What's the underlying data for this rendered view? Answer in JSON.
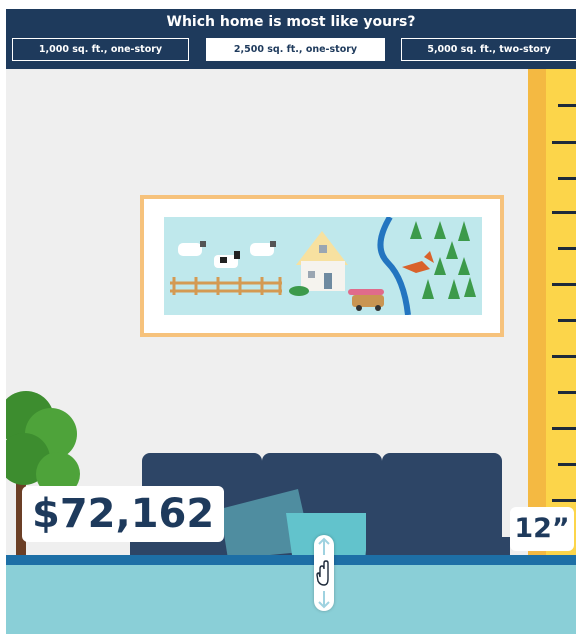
{
  "header": {
    "title": "Which home is most like yours?",
    "options": [
      {
        "label": "1,000 sq. ft., one-story",
        "selected": false
      },
      {
        "label": "2,500 sq. ft., one-story",
        "selected": true
      },
      {
        "label": "5,000 sq. ft., two-story",
        "selected": false
      }
    ]
  },
  "scene": {
    "damage_value": "$72,162",
    "water_depth": "12”",
    "drag_handle_icon": "hand-pointer-icon"
  },
  "colors": {
    "header_bg": "#1e3a5c",
    "ruler": "#fcd54a",
    "water": "#8acfd7",
    "sofa": "#2d4566"
  }
}
